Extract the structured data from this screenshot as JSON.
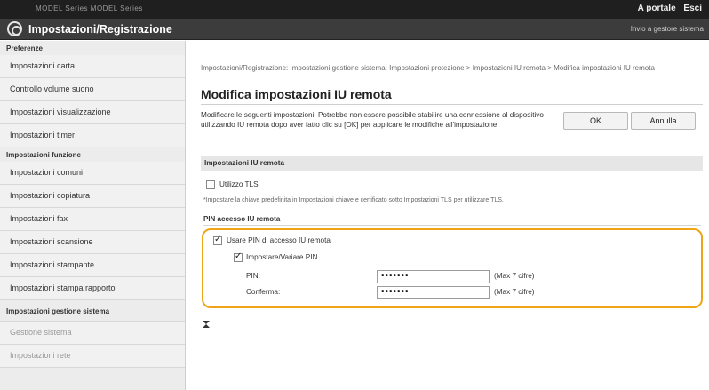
{
  "topbar": {
    "left_text": "MODEL Series MODEL Series",
    "portal_link": "A portale",
    "exit_link": "Esci"
  },
  "titlebar": {
    "title": "Impostazioni/Registrazione",
    "right_link": "Invio a gestore sistema"
  },
  "sidebar": {
    "preferences_header": "Preferenze",
    "preferences_items": [
      "Impostazioni carta",
      "Controllo volume suono",
      "Impostazioni visualizzazione",
      "Impostazioni timer"
    ],
    "functions_header": "Impostazioni funzione",
    "functions_items": [
      "Impostazioni comuni",
      "Impostazioni copiatura",
      "Impostazioni fax",
      "Impostazioni scansione",
      "Impostazioni stampante",
      "Impostazioni stampa rapporto"
    ],
    "system_header": "Impostazioni gestione sistema",
    "system_items": [
      "Gestione sistema",
      "Impostazioni rete"
    ]
  },
  "main": {
    "breadcrumb": "Impostazioni/Registrazione: Impostazioni gestione sistema: Impostazioni protezione > Impostazioni IU remota > Modifica impostazioni IU remota",
    "page_title": "Modifica impostazioni IU remota",
    "description": "Modificare le seguenti impostazioni. Potrebbe non essere possibile stabilire una connessione al dispositivo utilizzando IU remota dopo aver fatto clic su [OK] per applicare le modifiche all'impostazione.",
    "ok_label": "OK",
    "cancel_label": "Annulla",
    "section_title": "Impostazioni IU remota",
    "use_tls_label": "Utilizzo TLS",
    "use_tls_checked": false,
    "tls_note": "*Impostare la chiave predefinita in Impostazioni chiave e certificato sotto Impostazioni TLS per utilizzare TLS.",
    "pin_section_title": "PIN accesso IU remota",
    "use_pin_label": "Usare PIN di accesso IU remota",
    "use_pin_checked": true,
    "set_change_pin_label": "Impostare/Variare PIN",
    "set_change_pin_checked": true,
    "pin_label": "PIN:",
    "pin_value": "•••••••",
    "pin_hint": "(Max 7 cifre)",
    "confirm_label": "Conferma:",
    "confirm_value": "•••••••",
    "confirm_hint": "(Max 7 cifre)"
  },
  "colors": {
    "highlight": "#f0a517",
    "topbar": "#1f1f1f",
    "titlebar": "#3c3c3c",
    "sidebar": "#ececec"
  }
}
